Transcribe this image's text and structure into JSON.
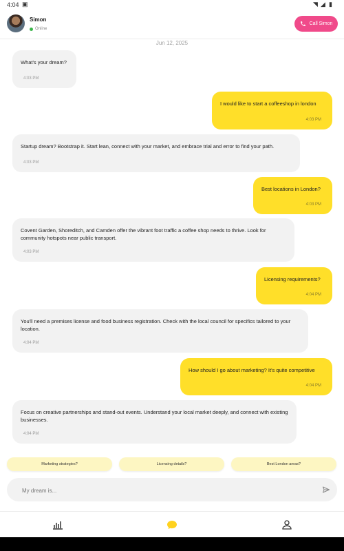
{
  "status_bar": {
    "time": "4:04"
  },
  "header": {
    "name": "Simon",
    "status": "Online",
    "call_label": "Call Simon"
  },
  "date": "Jun 12, 2025",
  "messages": [
    {
      "role": "bot",
      "text": "What's your dream?",
      "time": "4:03 PM"
    },
    {
      "role": "user",
      "text": "I would like to start a coffeeshop in london",
      "time": "4:03 PM"
    },
    {
      "role": "bot",
      "text": "Startup dream? Bootstrap it. Start lean, connect with your market, and embrace trial and error to find your path.",
      "time": "4:03 PM"
    },
    {
      "role": "user",
      "text": "Best locations in London?",
      "time": "4:03 PM"
    },
    {
      "role": "bot",
      "text": "Covent Garden, Shoreditch, and Camden offer the vibrant foot traffic a coffee shop needs to thrive. Look for community hotspots near public transport.",
      "time": "4:03 PM"
    },
    {
      "role": "user",
      "text": "Licensing requirements?",
      "time": "4:04 PM"
    },
    {
      "role": "bot",
      "text": "You'll need a premises license and food business registration. Check with the local council for specifics tailored to your location.",
      "time": "4:04 PM"
    },
    {
      "role": "user",
      "text": "How should I go about marketing? It's quite competitive",
      "time": "4:04 PM"
    },
    {
      "role": "bot",
      "text": "Focus on creative partnerships and stand-out events. Understand your local market deeply, and connect with existing businesses.",
      "time": "4:04 PM"
    }
  ],
  "suggestions": [
    "Marketing strategies?",
    "Licensing details?",
    "Best London areas?"
  ],
  "composer": {
    "placeholder": "My dream is..."
  },
  "nav": {
    "items": [
      "stats-icon",
      "chat-icon",
      "profile-icon"
    ],
    "active": "chat-icon"
  },
  "colors": {
    "accent_yellow": "#ffdf29",
    "call_pink": "#f04a8a",
    "online_green": "#3bb54a"
  }
}
